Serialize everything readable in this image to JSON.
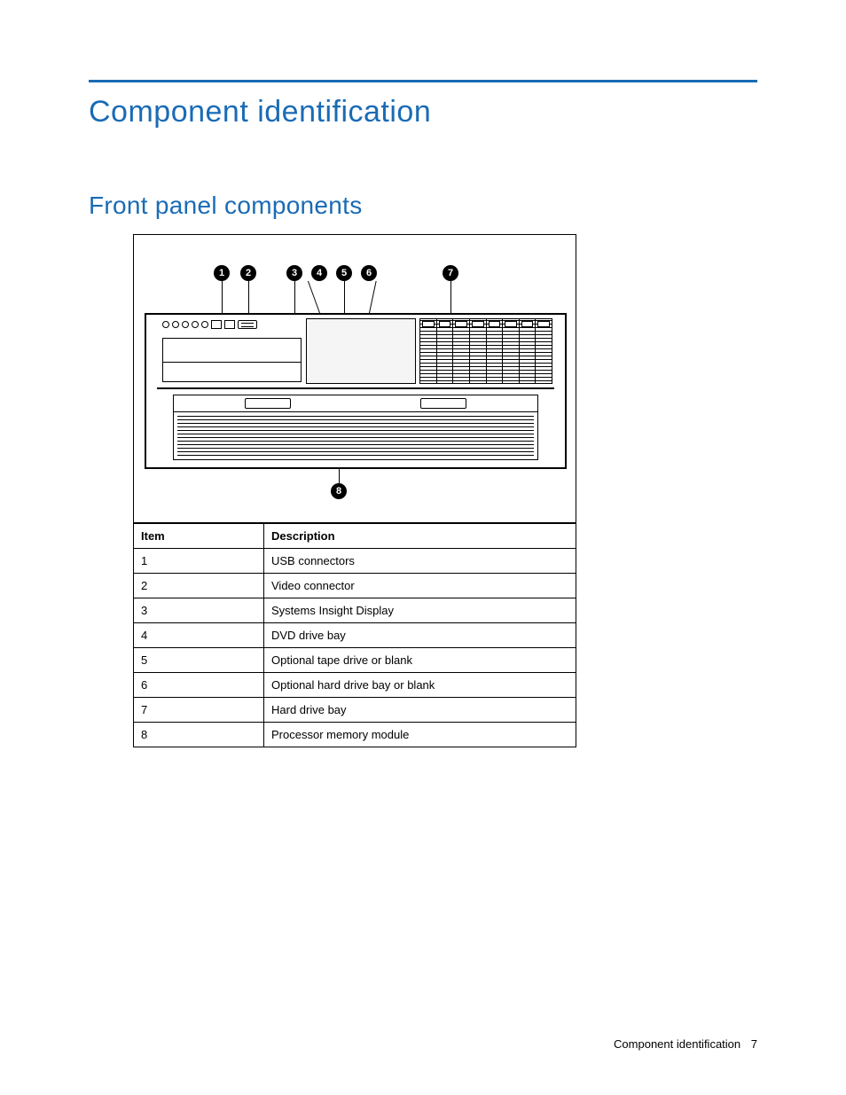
{
  "heading": "Component identification",
  "subheading": "Front panel components",
  "callouts": [
    "1",
    "2",
    "3",
    "4",
    "5",
    "6",
    "7",
    "8"
  ],
  "table": {
    "headers": {
      "item": "Item",
      "description": "Description"
    },
    "rows": [
      {
        "item": "1",
        "description": "USB connectors"
      },
      {
        "item": "2",
        "description": "Video connector"
      },
      {
        "item": "3",
        "description": "Systems Insight Display"
      },
      {
        "item": "4",
        "description": "DVD drive bay"
      },
      {
        "item": "5",
        "description": "Optional tape drive or blank"
      },
      {
        "item": "6",
        "description": "Optional hard drive bay or blank"
      },
      {
        "item": "7",
        "description": "Hard drive bay"
      },
      {
        "item": "8",
        "description": "Processor memory module"
      }
    ]
  },
  "footer": {
    "section": "Component identification",
    "page": "7"
  }
}
